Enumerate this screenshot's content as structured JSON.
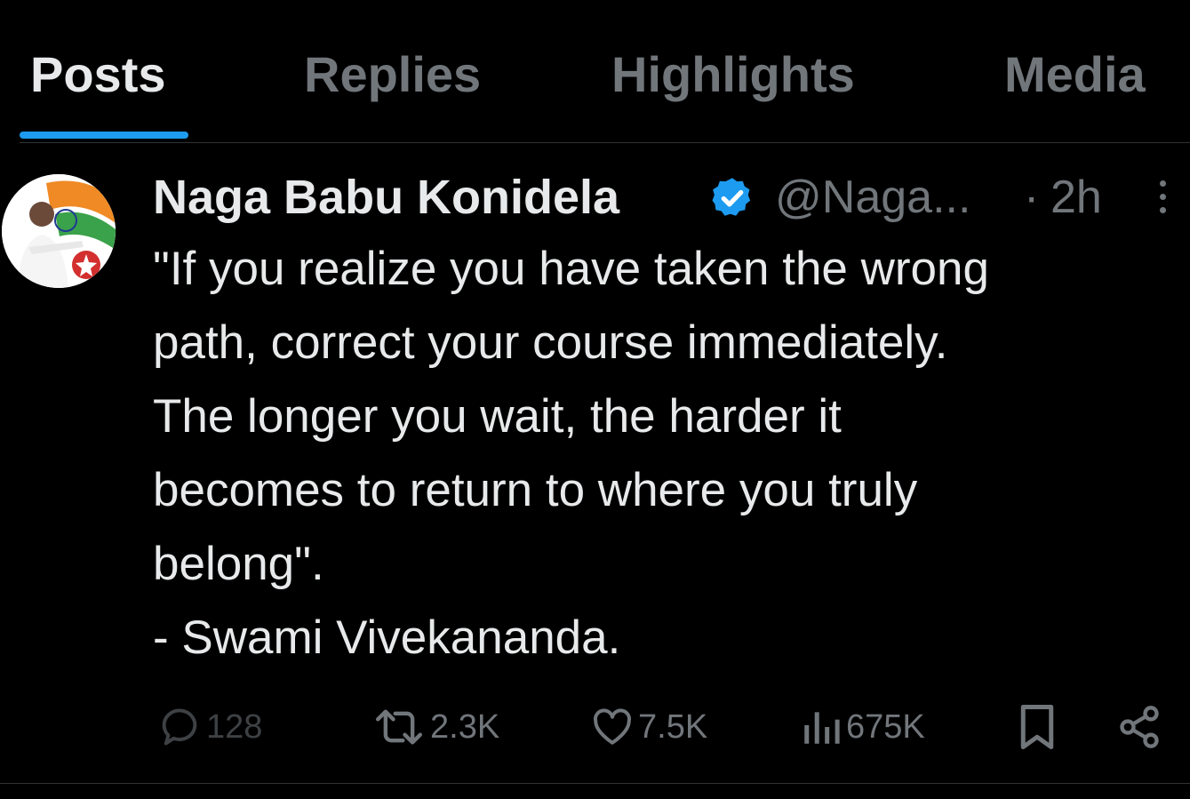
{
  "tabs": [
    {
      "label": "Posts",
      "active": true
    },
    {
      "label": "Replies",
      "active": false
    },
    {
      "label": "Highlights",
      "active": false
    },
    {
      "label": "Media",
      "active": false
    }
  ],
  "post": {
    "author_name": "Naga Babu Konidela",
    "verified": true,
    "handle": "@Naga...",
    "separator": "·",
    "time": "2h",
    "text_lines": [
      "\"If you realize you have taken the wrong",
      "path, correct your course immediately.",
      "The longer you wait, the harder it",
      "becomes to return to where you truly",
      "belong\".",
      "- Swami Vivekananda."
    ],
    "metrics": {
      "replies": "128",
      "reposts": "2.3K",
      "likes": "7.5K",
      "views": "675K"
    }
  },
  "colors": {
    "background": "#000000",
    "accent": "#1d9bf0",
    "text_primary": "#e7e9ea",
    "text_secondary": "#71767b",
    "divider": "#2f3336"
  },
  "icons": {
    "verified": "verified-badge-icon",
    "more": "more-vertical-icon",
    "reply": "comment-bubble-icon",
    "repost": "repost-icon",
    "like": "heart-icon",
    "views": "analytics-bars-icon",
    "bookmark": "bookmark-icon",
    "share": "share-nodes-icon"
  }
}
